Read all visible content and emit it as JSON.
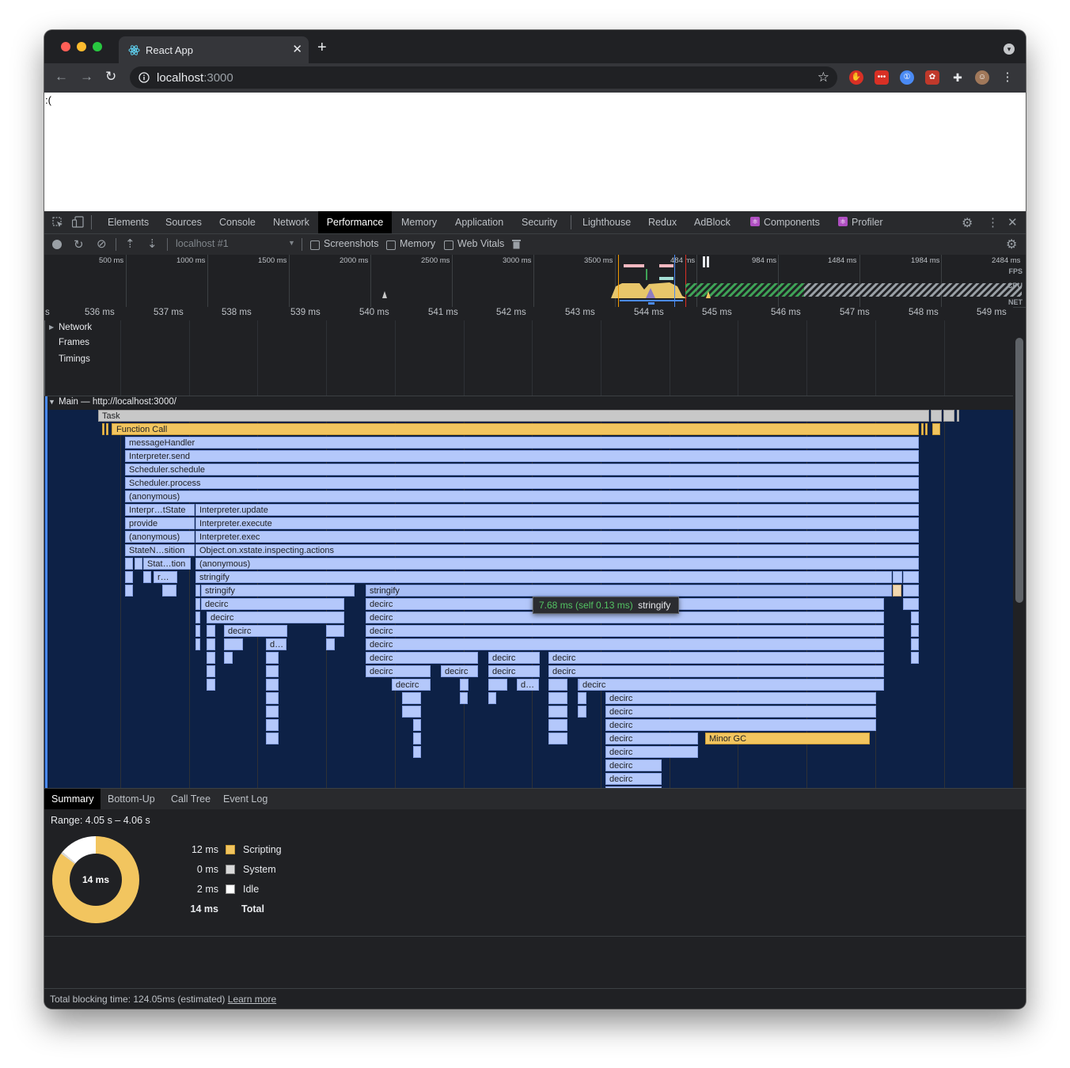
{
  "browser": {
    "tab_title": "React App",
    "tab_close": "✕",
    "new_tab": "+",
    "url_host": "localhost",
    "url_port": ":3000"
  },
  "page": {
    "content": ":("
  },
  "devtools": {
    "tabs": [
      "Elements",
      "Sources",
      "Console",
      "Network",
      "Performance",
      "Memory",
      "Application",
      "Security",
      "Lighthouse",
      "Redux",
      "AdBlock",
      "Components",
      "Profiler"
    ],
    "active_tab": "Performance",
    "perf_toolbar": {
      "profile_select": "localhost #1",
      "screenshots": "Screenshots",
      "memory": "Memory",
      "web_vitals": "Web Vitals"
    },
    "overview": {
      "ticks": [
        "500 ms",
        "1000 ms",
        "1500 ms",
        "2000 ms",
        "2500 ms",
        "3000 ms",
        "3500 ms",
        "484 ms",
        "984 ms",
        "1484 ms",
        "1984 ms",
        "2484 ms"
      ],
      "labels": [
        "FPS",
        "CPU",
        "NET"
      ]
    },
    "ruler": [
      "s",
      "536 ms",
      "537 ms",
      "538 ms",
      "539 ms",
      "540 ms",
      "541 ms",
      "542 ms",
      "543 ms",
      "544 ms",
      "545 ms",
      "546 ms",
      "547 ms",
      "548 ms",
      "549 ms"
    ],
    "tracks": {
      "network": "Network",
      "frames": "Frames",
      "timings": "Timings",
      "main": "Main — http://localhost:3000/"
    },
    "flame": {
      "task": "Task",
      "function_call": "Function Call",
      "message_handler": "messageHandler",
      "interpreter_send": "Interpreter.send",
      "scheduler_schedule": "Scheduler.schedule",
      "scheduler_process": "Scheduler.process",
      "anonymous": "(anonymous)",
      "interpr_tstate": "Interpr…tState",
      "interpreter_update": "Interpreter.update",
      "provide": "provide",
      "interpreter_execute": "Interpreter.execute",
      "interpreter_exec": "Interpreter.exec",
      "staten_sition": "StateN…sition",
      "object_actions": "Object.on.xstate.inspecting.actions",
      "stat_tion": "Stat…tion",
      "r_ellipsis": "r…",
      "stringify": "stringify",
      "decirc": "decirc",
      "d_ellipsis": "d…",
      "minor_gc": "Minor GC"
    },
    "tooltip": {
      "time": "7.68 ms (self 0.13 ms)",
      "name": "stringify"
    },
    "bottom_tabs": [
      "Summary",
      "Bottom-Up",
      "Call Tree",
      "Event Log"
    ],
    "active_bottom_tab": "Summary",
    "summary": {
      "range": "Range: 4.05 s – 4.06 s",
      "total_center": "14 ms",
      "legend": [
        {
          "value": "12 ms",
          "name": "Scripting",
          "color": "#f2c55f"
        },
        {
          "value": "0 ms",
          "name": "System",
          "color": "#d9d9d9"
        },
        {
          "value": "2 ms",
          "name": "Idle",
          "color": "#ffffff"
        }
      ],
      "total_value": "14 ms",
      "total_label": "Total"
    },
    "status": {
      "text": "Total blocking time: 124.05ms (estimated)",
      "link": "Learn more"
    }
  },
  "colors": {
    "scripting": "#f2c55f",
    "call_bar": "#b4c8fb",
    "main_bg": "#0d2146",
    "active_tab_bg": "#000000"
  }
}
